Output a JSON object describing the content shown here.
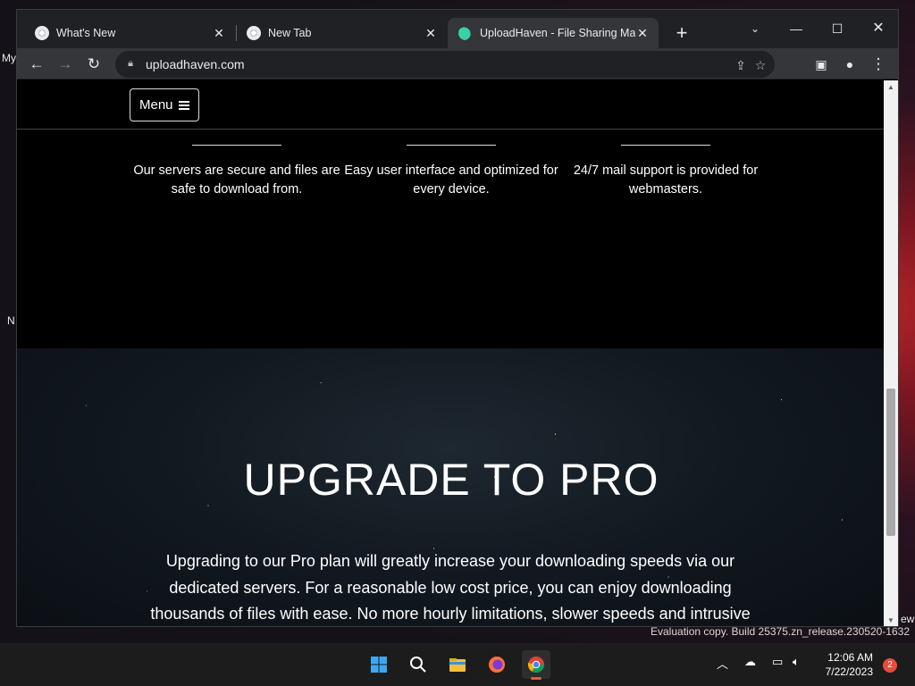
{
  "desktop": {
    "left_fragments": [
      "My",
      "N"
    ],
    "right_fragment": "ew",
    "evaluation_text": "Evaluation copy. Build 25375.zn_release.230520-1632"
  },
  "tabs": [
    {
      "title": "What's New",
      "favicon": "chrome-icon",
      "active": false
    },
    {
      "title": "New Tab",
      "favicon": "chrome-icon",
      "active": false
    },
    {
      "title": "UploadHaven - File Sharing Made Simple",
      "favicon": "cloud-upload-icon",
      "active": true
    }
  ],
  "omnibox": {
    "url": "uploadhaven.com"
  },
  "site": {
    "menu_label": "Menu",
    "features": [
      {
        "text": "Our servers are secure and files are safe to download from."
      },
      {
        "text": "Easy user interface and optimized for every device."
      },
      {
        "text": "24/7 mail support is provided for webmasters."
      }
    ],
    "pro_title": "UPGRADE TO PRO",
    "pro_description": "Upgrading to our Pro plan will greatly increase your downloading speeds via our dedicated servers. For a reasonable low cost price, you can enjoy downloading thousands of files with ease. No more hourly limitations, slower speeds and intrusive"
  },
  "taskbar": {
    "time": "12:06 AM",
    "date": "7/22/2023",
    "notification_count": "2"
  },
  "colors": {
    "tab_strip": "#202124",
    "toolbar": "#35363a",
    "accent": "#e25b36"
  }
}
